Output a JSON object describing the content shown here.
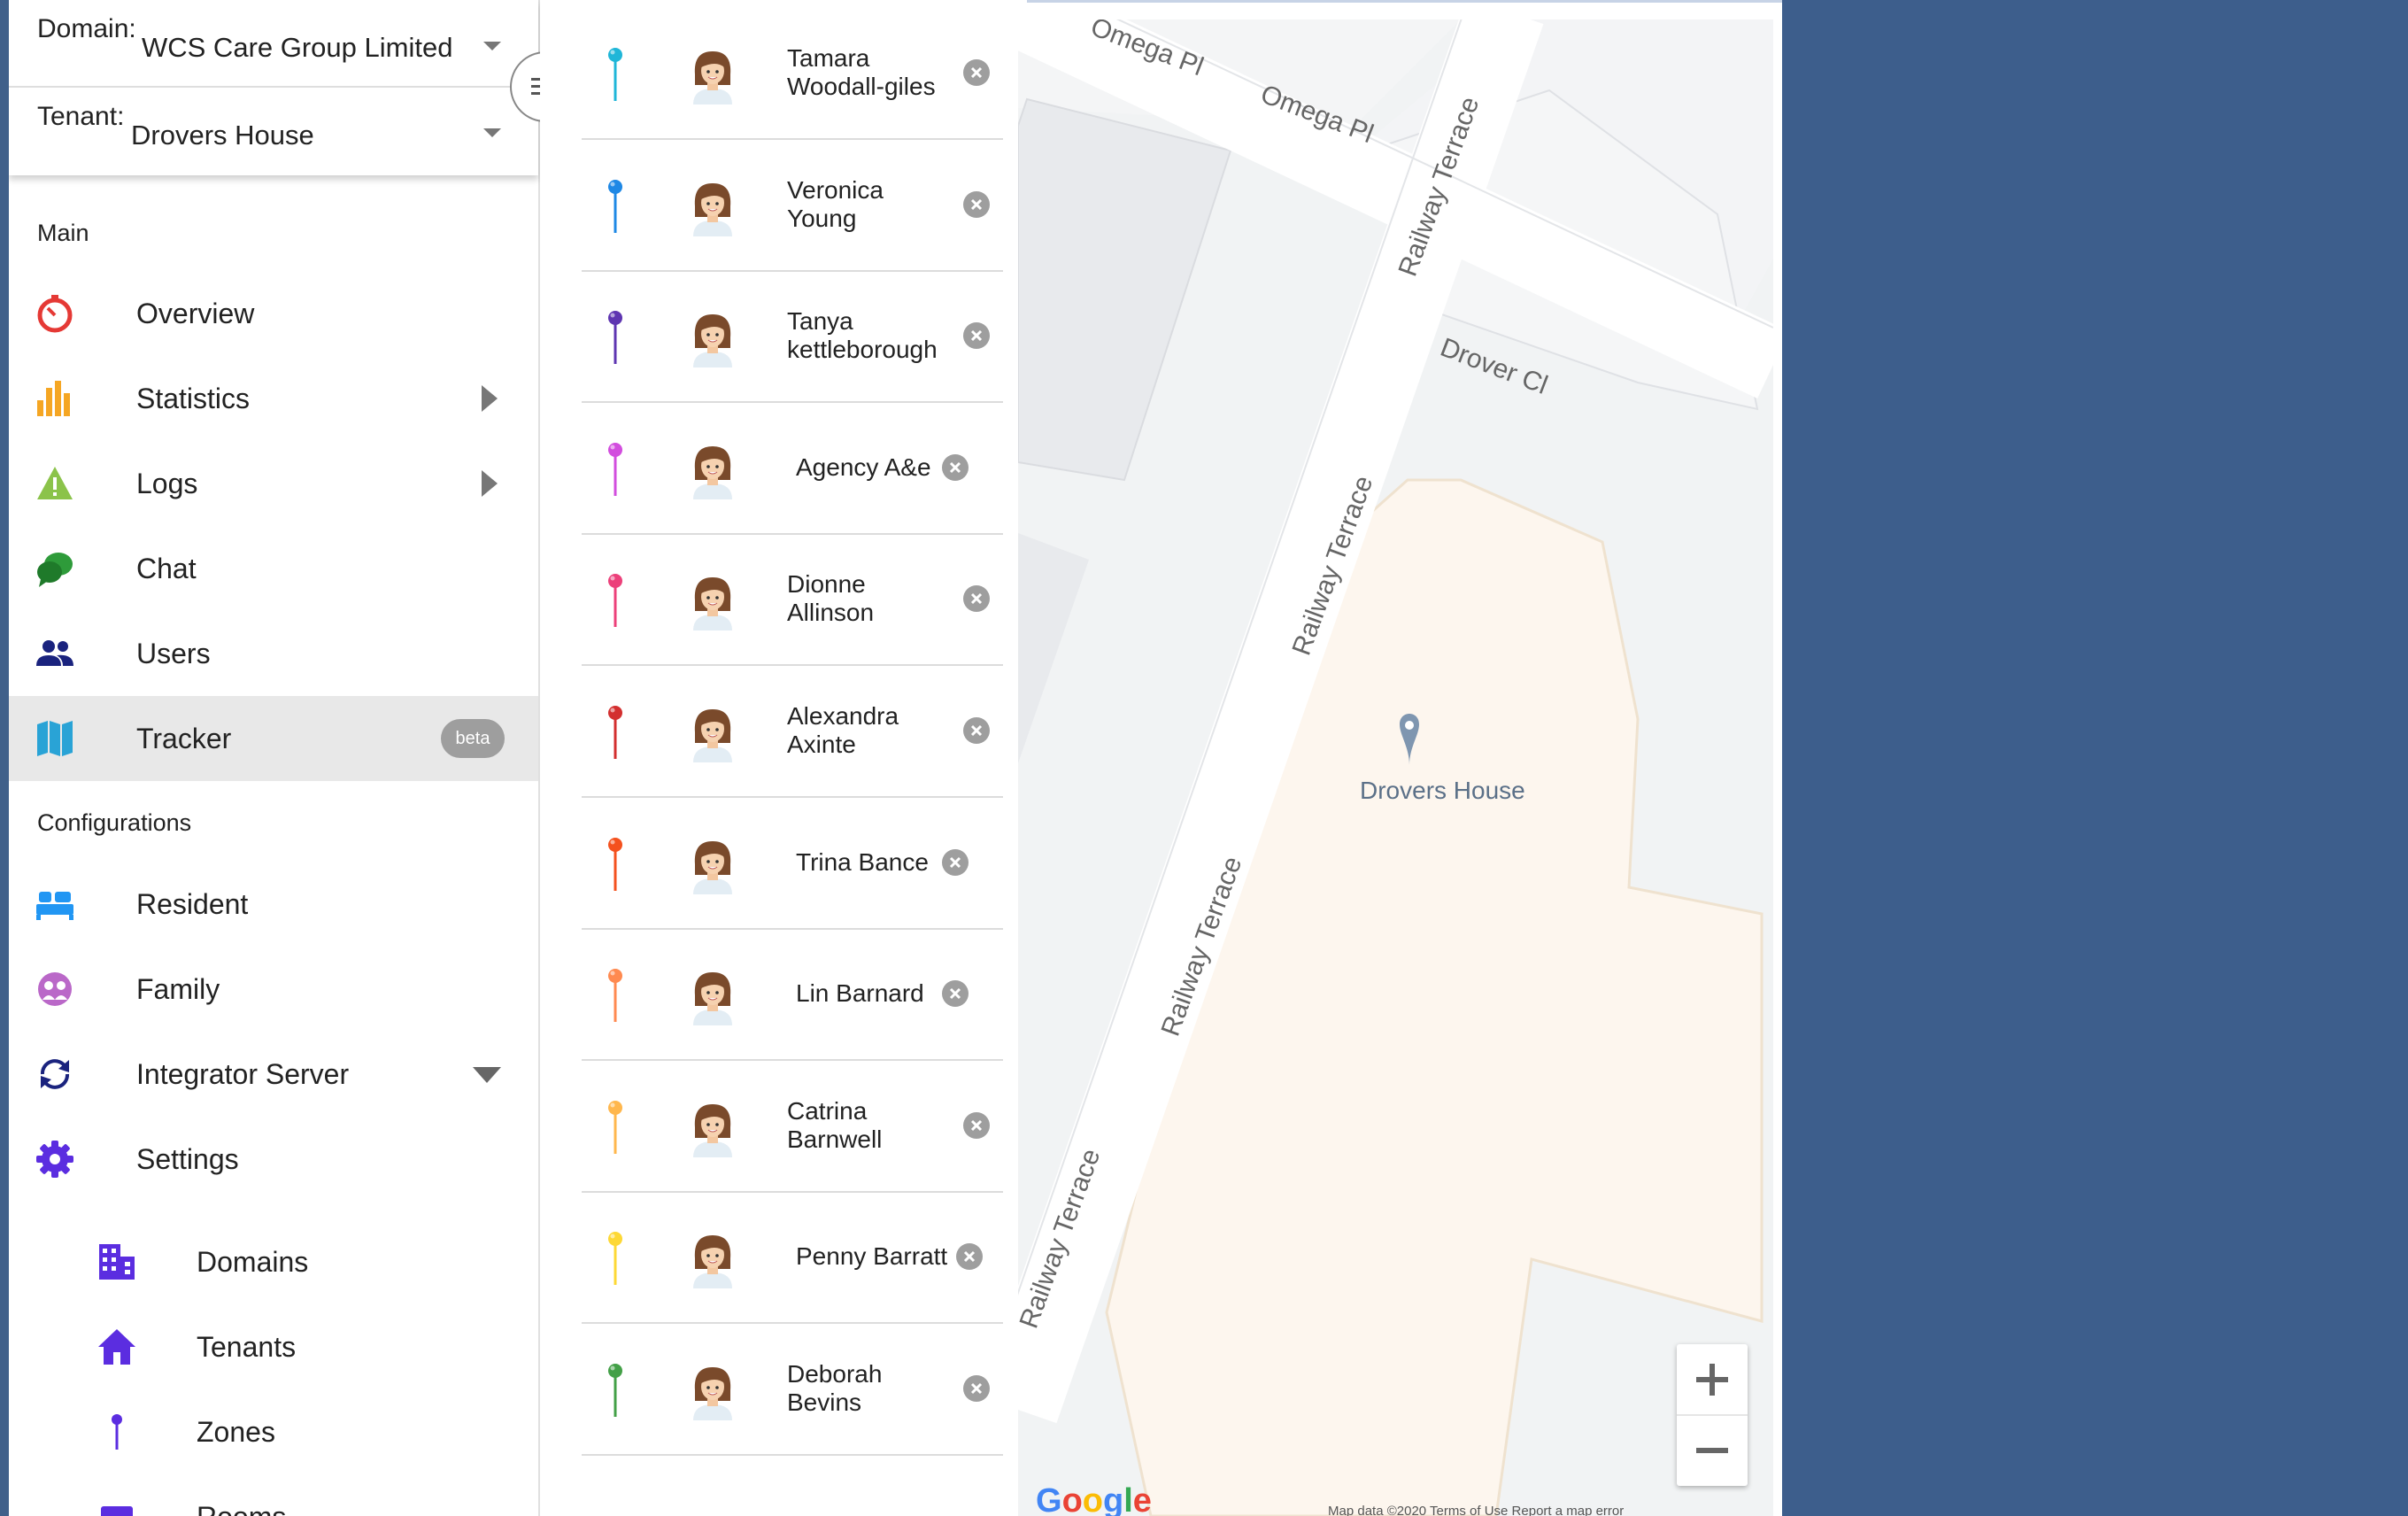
{
  "selectors": {
    "domain_label": "Domain:",
    "domain_value": "WCS Care Group Limited",
    "tenant_label": "Tenant:",
    "tenant_value": "Drovers House"
  },
  "sidebar": {
    "section_main": "Main",
    "section_config": "Configurations",
    "main_items": [
      {
        "label": "Overview",
        "icon": "stopwatch-icon",
        "color": "#e53935"
      },
      {
        "label": "Statistics",
        "icon": "bar-chart-icon",
        "color": "#f5a623"
      },
      {
        "label": "Logs",
        "icon": "warning-icon",
        "color": "#8bc34a"
      },
      {
        "label": "Chat",
        "icon": "chat-bubbles-icon",
        "color": "#2e9b3a"
      },
      {
        "label": "Users",
        "icon": "users-icon",
        "color": "#1a237e"
      },
      {
        "label": "Tracker",
        "icon": "map-icon",
        "color": "#29a3d6",
        "badge": "beta"
      }
    ],
    "config_items": [
      {
        "label": "Resident",
        "icon": "bed-icon",
        "color": "#2196f3"
      },
      {
        "label": "Family",
        "icon": "family-icon",
        "color": "#ba68c8"
      },
      {
        "label": "Integrator Server",
        "icon": "sync-icon",
        "color": "#1a237e"
      },
      {
        "label": "Settings",
        "icon": "gear-icon",
        "color": "#5b2de0"
      }
    ],
    "settings_items": [
      {
        "label": "Domains",
        "icon": "building-icon",
        "color": "#5b2de0"
      },
      {
        "label": "Tenants",
        "icon": "home-icon",
        "color": "#5b2de0"
      },
      {
        "label": "Zones",
        "icon": "pin-icon",
        "color": "#5b2de0"
      },
      {
        "label": "Rooms",
        "icon": "room-icon",
        "color": "#5b2de0"
      }
    ]
  },
  "users": [
    {
      "name": "Tamara\nWoodall-giles",
      "pin_color": "#1fb6d8"
    },
    {
      "name": "Veronica\nYoung",
      "pin_color": "#1e88e5"
    },
    {
      "name": "Tanya\nkettleborough",
      "pin_color": "#5e35b1"
    },
    {
      "name": "Agency A&e",
      "pin_color": "#d24dde"
    },
    {
      "name": "Dionne\nAllinson",
      "pin_color": "#ec407a"
    },
    {
      "name": "Alexandra\nAxinte",
      "pin_color": "#d32f2f"
    },
    {
      "name": "Trina Bance",
      "pin_color": "#f4511e"
    },
    {
      "name": "Lin Barnard",
      "pin_color": "#ff8a50"
    },
    {
      "name": "Catrina\nBarnwell",
      "pin_color": "#ffb74d"
    },
    {
      "name": "Penny Barratt",
      "pin_color": "#fdd835"
    },
    {
      "name": "Deborah\nBevins",
      "pin_color": "#43a047"
    }
  ],
  "map": {
    "streets": [
      "Omega Pl",
      "Omega Pl",
      "Railway Terrace",
      "Drover Cl",
      "Railway Terrace",
      "Railway Terrace",
      "Railway Terrace"
    ],
    "place_label": "Drovers House",
    "zoom_in": "+",
    "zoom_out": "−",
    "logo": "Google",
    "footer": "Map data ©2020    Terms of Use    Report a map error"
  }
}
